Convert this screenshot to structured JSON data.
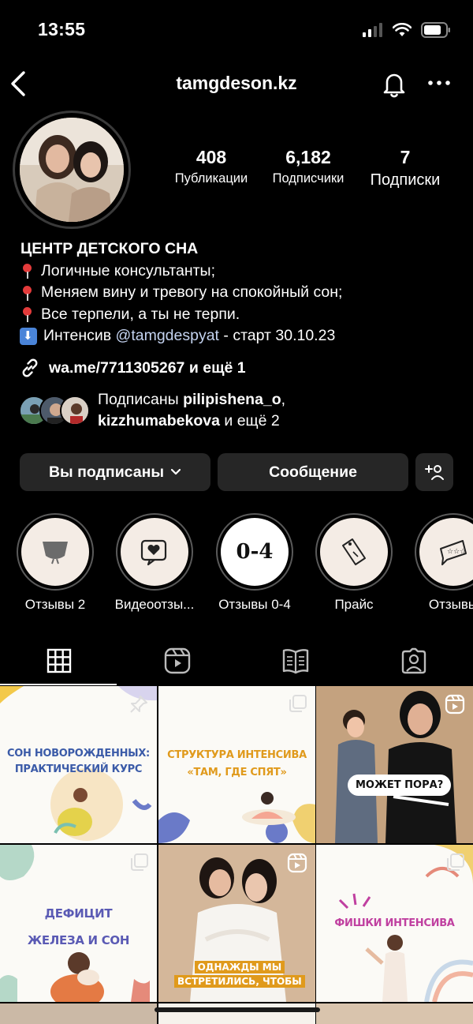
{
  "status_bar": {
    "time": "13:55"
  },
  "header": {
    "username": "tamgdeson.kz"
  },
  "stats": [
    {
      "value": "408",
      "label": "Публикации"
    },
    {
      "value": "6,182",
      "label": "Подписчики"
    },
    {
      "value": "7",
      "label": "Подписки"
    }
  ],
  "bio": {
    "name": "ЦЕНТР ДЕТСКОГО СНА",
    "lines": [
      "Логичные консультанты;",
      "Меняем вину и тревогу на спокойный сон;",
      "Все терпели, а ты не терпи."
    ],
    "intensive_prefix": "Интенсив ",
    "intensive_mention": "@tamgdespyat",
    "intensive_suffix": " - старт 30.10.23",
    "link": "wa.me/7711305267 и ещё 1"
  },
  "followed_by": {
    "prefix": "Подписаны ",
    "user1": "pilipishena_o",
    "sep": ",",
    "user2": "kizzhumabekova",
    "suffix": " и ещё 2"
  },
  "actions": {
    "following": "Вы подписаны",
    "message": "Сообщение"
  },
  "highlights": [
    {
      "label": "Отзывы 2"
    },
    {
      "label": "Видеоотзы..."
    },
    {
      "label": "Отзывы 0-4",
      "cover_text": "0-4"
    },
    {
      "label": "Прайс"
    },
    {
      "label": "Отзывы"
    }
  ],
  "posts": [
    {
      "line1": "СОН НОВОРОЖДЕННЫХ:",
      "line2": "ПРАКТИЧЕСКИЙ КУРС"
    },
    {
      "line1": "СТРУКТУРА ИНТЕНСИВА",
      "line2": "«ТАМ, ГДЕ СПЯТ»"
    },
    {
      "line1": "МОЖЕТ ПОРА?"
    },
    {
      "line1": "ДЕФИЦИТ",
      "line2": "ЖЕЛЕЗА И СОН"
    },
    {
      "line1": "ОДНАЖДЫ МЫ",
      "line2": "ВСТРЕТИЛИСЬ, ЧТОБЫ"
    },
    {
      "line1": "ФИШКИ ИНТЕНСИВА"
    }
  ],
  "colors": {
    "background": "#000000",
    "button": "#262626",
    "mention": "#c4d3f0",
    "post_purple": "#5a5ab4",
    "post_orange": "#e09a1c"
  }
}
